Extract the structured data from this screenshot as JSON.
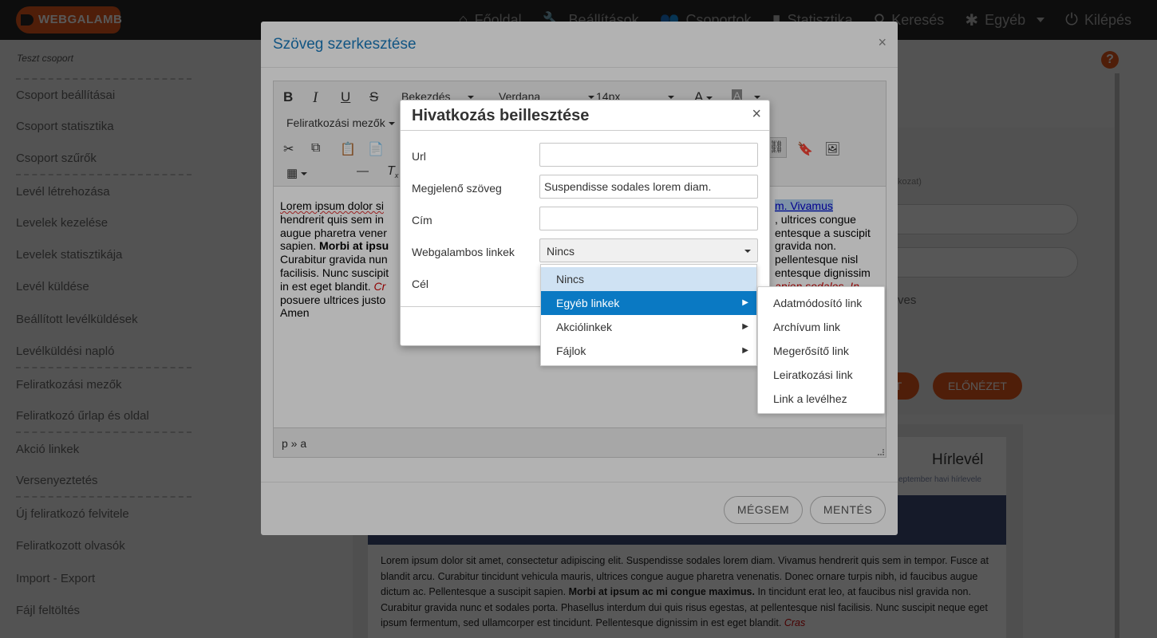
{
  "app": {
    "logo_text": "WEBGALAMB"
  },
  "nav": {
    "items": [
      {
        "label": "Főoldal",
        "icon": "home-icon"
      },
      {
        "label": "Beállítások",
        "icon": "wrench-icon"
      },
      {
        "label": "Csoportok",
        "icon": "group-icon"
      },
      {
        "label": "Statisztika",
        "icon": "bar-chart-icon"
      },
      {
        "label": "Keresés",
        "icon": "search-icon"
      },
      {
        "label": "Egyéb",
        "icon": "asterisk-icon"
      },
      {
        "label": "Kilépés",
        "icon": "power-icon"
      }
    ]
  },
  "sidebar": {
    "group_name": "Teszt csoport",
    "items": [
      "Csoport beállításai",
      "Csoport statisztika",
      "Csoport szűrők",
      "Levél létrehozása",
      "Levelek kezelése",
      "Levelek statisztikája",
      "Levél küldése",
      "Beállított levélküldések",
      "Levélküldési napló",
      "Feliratkozási mezők",
      "Feliratkozó űrlap és oldal",
      "Akció linkek",
      "Versenyeztetés",
      "Új feliratkozó felvitele",
      "Feliratkozott olvasók",
      "Import - Export",
      "Fájl feltöltés"
    ]
  },
  "background": {
    "help_label": "?",
    "field_label_fragment": "kozat)",
    "text_fragment": "ves",
    "button_fragment": "T",
    "preview_button": "ELŐNÉZET",
    "newsletter_title": "Hírlevél",
    "newsletter_subtitle": "eptember havi hírlevele",
    "newsletter_body_1": "Lorem ipsum dolor sit amet, consectetur adipiscing elit. Suspendisse sodales lorem diam. Vivamus hendrerit quis sem in tempor. Fusce at blandit arcu. Curabitur tincidunt vehicula mauris, ultrices congue augue pharetra venenatis. Donec ornare turpis nibh, id faucibus augue dictum ac. Pellentesque a suscipit sapien.",
    "newsletter_body_bold": "Morbi at ipsum ac mi congue maximus.",
    "newsletter_body_2": "In tincidunt erat leo, at faucibus nisl gravida non. Curabitur gravida nunc et sodales porta. Phasellus interdum dui quis risus egestas, at pellentesque nisl facilisis. Nunc suscipit neque eget ipsum fermentum, sed ullamcorper est tincidunt. Pellentesque dignissim in est eget blandit.",
    "newsletter_body_red": "Cras"
  },
  "editor_modal": {
    "title": "Szöveg szerkesztése",
    "close": "×",
    "toolbar": {
      "bold": "B",
      "italic": "I",
      "underline": "U",
      "strike": "S",
      "format": "Bekezdés",
      "font": "Verdana",
      "size": "14px",
      "subscription_fields": "Feliratkozási mezők"
    },
    "content": {
      "left_lines": [
        "Lorem ipsum dolor si",
        "hendrerit quis sem in",
        "augue pharetra vener",
        "sapien.",
        "Curabitur gravida nun",
        "facilisis. Nunc suscipit",
        "in est eget blandit.",
        "posuere ultrices justo",
        "Amen"
      ],
      "bold_fragment": "Morbi at ipsu",
      "red_fragment": "Cr",
      "right_lines": [
        "m. Vivamus",
        ", ultrices congue",
        "entesque a suscipit",
        "gravida non.",
        "pellentesque nisl",
        "entesque dignissim",
        "apien sodales. In",
        ""
      ]
    },
    "status_path": "p » a",
    "cancel_button": "MÉGSEM",
    "save_button": "MENTÉS"
  },
  "link_dialog": {
    "title": "Hivatkozás beillesztése",
    "close": "×",
    "url_label": "Url",
    "url_value": "",
    "text_label": "Megjelenő szöveg",
    "text_value": "Suspendisse sodales lorem diam.",
    "title_label": "Cím",
    "title_value": "",
    "links_label": "Webgalambos linkek",
    "links_selected": "Nincs",
    "target_label": "Cél"
  },
  "links_menu": {
    "items": [
      {
        "label": "Nincs",
        "has_submenu": false
      },
      {
        "label": "Egyéb linkek",
        "has_submenu": true
      },
      {
        "label": "Akciólinkek",
        "has_submenu": true
      },
      {
        "label": "Fájlok",
        "has_submenu": true
      }
    ]
  },
  "submenu": {
    "items": [
      "Adatmódosító link",
      "Archívum link",
      "Megerősítő link",
      "Leiratkozási link",
      "Link a levélhez"
    ]
  },
  "colors": {
    "brand": "#e4561b",
    "modal_title": "#1a7abc",
    "menu_active": "#0a79c3",
    "menu_hover": "#cfe2f3"
  }
}
